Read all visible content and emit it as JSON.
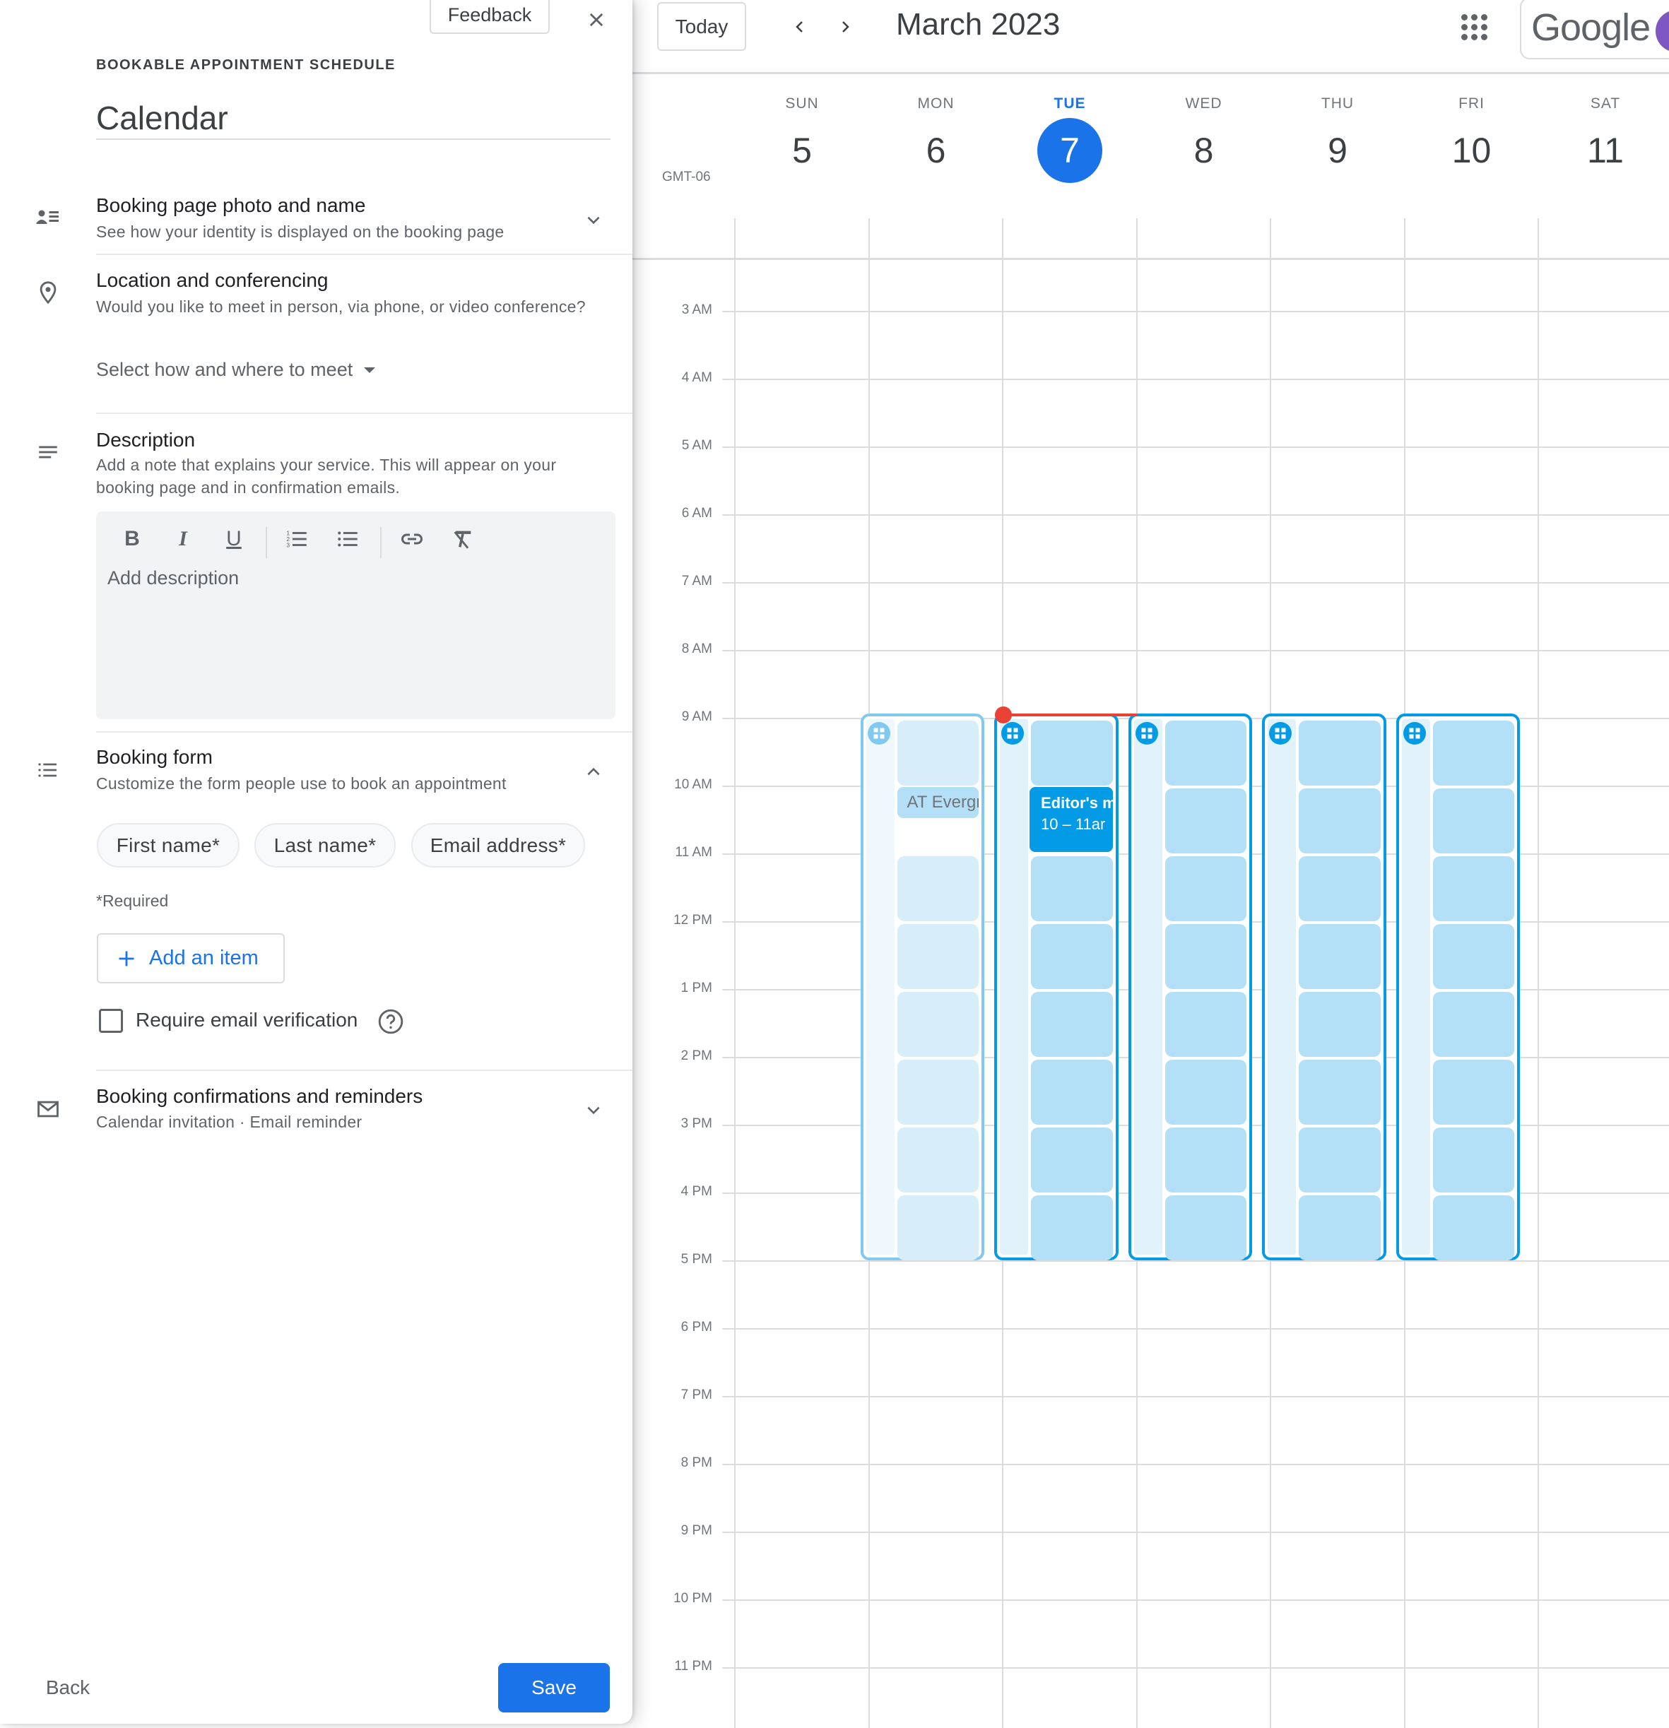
{
  "panel": {
    "feedback_label": "Feedback",
    "eyebrow": "BOOKABLE APPOINTMENT SCHEDULE",
    "title_value": "Calendar",
    "sections": {
      "booking_page": {
        "heading": "Booking page photo and name",
        "subtitle": "See how your identity is displayed on the booking page",
        "icon": "person-list-icon",
        "expanded": false
      },
      "location": {
        "heading": "Location and conferencing",
        "subtitle": "Would you like to meet in person, via phone, or video conference?",
        "icon": "location-pin-icon",
        "select_label": "Select how and where to meet"
      },
      "description": {
        "heading": "Description",
        "subtitle": "Add a note that explains your service. This will appear on your booking page and in confirmation emails.",
        "icon": "notes-icon",
        "placeholder": "Add description",
        "toolbar": [
          "bold",
          "italic",
          "underline",
          "numbered-list",
          "bulleted-list",
          "link",
          "clear-formatting"
        ],
        "toolbar_glyphs": {
          "bold": "B",
          "italic": "I",
          "underline": "U"
        }
      },
      "booking_form": {
        "heading": "Booking form",
        "subtitle": "Customize the form people use to book an appointment",
        "icon": "list-icon",
        "expanded": true,
        "fields": [
          "First name*",
          "Last name*",
          "Email address*"
        ],
        "required_note": "*Required",
        "add_item_label": "Add an item",
        "verify_label": "Require email verification",
        "verify_checked": false
      },
      "confirmations": {
        "heading": "Booking confirmations and reminders",
        "subtitle": "Calendar invitation · Email reminder",
        "icon": "mail-icon",
        "expanded": false
      }
    },
    "back_label": "Back",
    "save_label": "Save"
  },
  "calendar": {
    "today_label": "Today",
    "month_title": "March 2023",
    "brand": "Google",
    "timezone": "GMT-06",
    "days": [
      {
        "name": "SUN",
        "num": "5",
        "today": false
      },
      {
        "name": "MON",
        "num": "6",
        "today": false
      },
      {
        "name": "TUE",
        "num": "7",
        "today": true
      },
      {
        "name": "WED",
        "num": "8",
        "today": false
      },
      {
        "name": "THU",
        "num": "9",
        "today": false
      },
      {
        "name": "FRI",
        "num": "10",
        "today": false
      },
      {
        "name": "SAT",
        "num": "11",
        "today": false
      }
    ],
    "hours": [
      "3 AM",
      "4 AM",
      "5 AM",
      "6 AM",
      "7 AM",
      "8 AM",
      "9 AM",
      "10 AM",
      "11 AM",
      "12 PM",
      "1 PM",
      "2 PM",
      "3 PM",
      "4 PM",
      "5 PM",
      "6 PM",
      "7 PM",
      "8 PM",
      "9 PM",
      "10 PM",
      "11 PM"
    ],
    "appointment_schedule": {
      "start": "9 AM",
      "end": "5 PM",
      "days": [
        "MON",
        "TUE",
        "WED",
        "THU",
        "FRI"
      ],
      "slot_count": 8
    },
    "events": [
      {
        "day": "MON",
        "title": "AT Evergr",
        "time": "",
        "style": "past"
      },
      {
        "day": "TUE",
        "title": "Editor's m",
        "time": "10 – 11ar",
        "style": "solid"
      }
    ],
    "colors": {
      "accent": "#1a73e8",
      "schedule": "#039be5",
      "slot": "#b3e0f6",
      "now_line": "#ea4335",
      "avatar": "#7e57c2"
    }
  }
}
